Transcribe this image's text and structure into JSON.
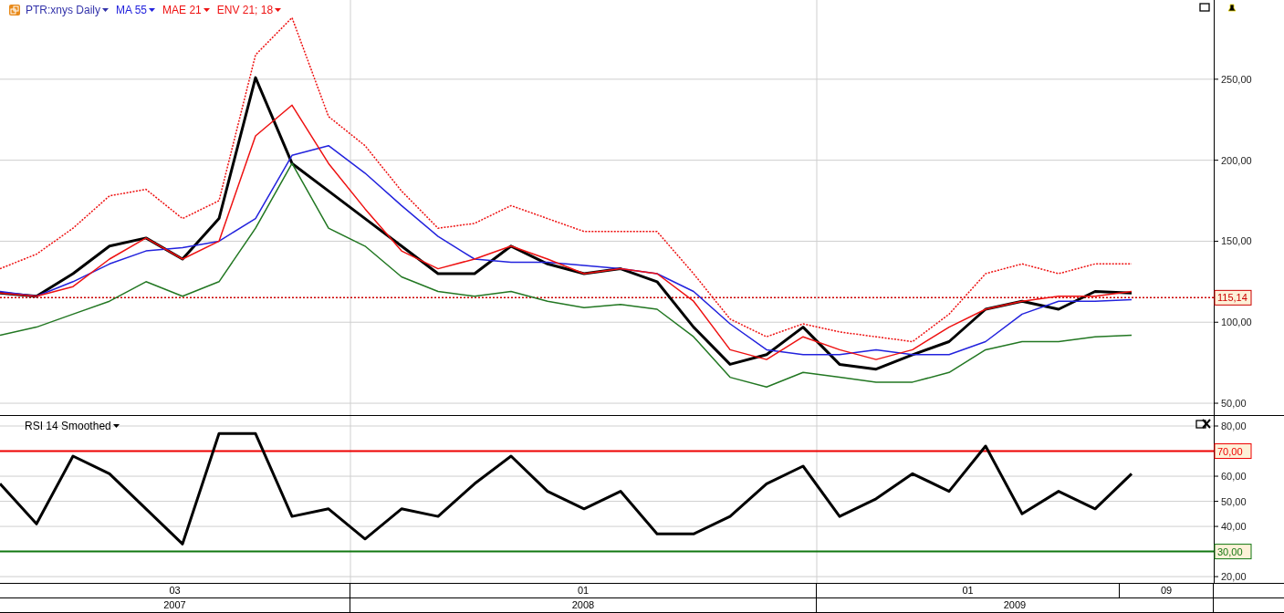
{
  "price_panel": {
    "legend": [
      {
        "label": "PTR:xnys Daily",
        "color": "#3333aa"
      },
      {
        "label": "MA 55",
        "color": "#2222dd"
      },
      {
        "label": "MAE 21",
        "color": "#ee1111"
      },
      {
        "label": "ENV 21; 18",
        "color": "#ee1111"
      }
    ],
    "chart_data": {
      "type": "line",
      "categories": [
        null,
        null,
        null,
        null,
        null,
        null,
        null,
        null,
        null,
        null,
        null,
        null,
        null,
        null,
        null,
        null,
        null,
        null,
        null,
        null,
        null,
        null,
        null,
        null,
        null,
        null,
        null,
        null,
        null,
        null,
        null,
        null
      ],
      "ylim": [
        42.7,
        298.9
      ],
      "grid": true,
      "yticks": [
        {
          "value": 250,
          "label": "250,00"
        },
        {
          "value": 200,
          "label": "200,00"
        },
        {
          "value": 150,
          "label": "150,00"
        },
        {
          "value": 100,
          "label": "100,00"
        },
        {
          "value": 50,
          "label": "50,00"
        }
      ],
      "series": [
        {
          "color": "#000000",
          "line_style": "solid",
          "values": [
            118,
            116,
            130,
            147,
            152,
            139,
            164,
            251,
            198,
            181,
            164,
            147,
            130,
            130,
            147,
            136,
            130,
            133,
            125,
            97,
            74,
            80,
            97,
            74,
            71,
            80,
            88,
            108,
            113,
            108,
            119,
            118
          ]
        },
        {
          "color": "#2222dd",
          "line_style": "solid",
          "values": [
            119,
            116,
            125,
            136,
            144,
            146,
            150,
            164,
            203,
            209,
            192,
            172,
            153,
            139,
            137,
            137,
            135,
            133,
            130,
            119,
            99,
            83,
            80,
            80,
            83,
            80,
            80,
            88,
            105,
            113,
            113,
            114
          ]
        },
        {
          "color": "#ee1111",
          "line_style": "solid",
          "values": [
            118,
            116,
            122,
            139,
            152,
            139,
            150,
            215,
            234,
            198,
            170,
            144,
            133,
            139,
            147,
            139,
            130,
            133,
            130,
            113,
            83,
            77,
            91,
            83,
            77,
            83,
            97,
            108,
            113,
            116,
            116,
            119
          ]
        },
        {
          "color": "#ee1111",
          "line_style": "dotted",
          "values": [
            133,
            142,
            158,
            178,
            182,
            164,
            175,
            265,
            288,
            227,
            209,
            181,
            158,
            161,
            172,
            164,
            156,
            156,
            156,
            130,
            102,
            91,
            99,
            94,
            91,
            88,
            105,
            130,
            136,
            130,
            136,
            136
          ]
        },
        {
          "color": "#227722",
          "line_style": "solid",
          "values": [
            92,
            97,
            105,
            113,
            125,
            116,
            125,
            158,
            198,
            158,
            147,
            128,
            119,
            116,
            119,
            113,
            109,
            111,
            108,
            91,
            66,
            60,
            69,
            66,
            63,
            63,
            69,
            83,
            88,
            88,
            91,
            92
          ]
        }
      ],
      "ref_lines": [
        {
          "axis": "y",
          "value": 115.14,
          "label": "115,14",
          "color": "#cc0000"
        }
      ]
    }
  },
  "rsi_panel": {
    "legend": [
      {
        "label": "RSI 14 Smoothed",
        "color": "#000000"
      }
    ],
    "chart_data": {
      "type": "line",
      "categories": [
        null,
        null,
        null,
        null,
        null,
        null,
        null,
        null,
        null,
        null,
        null,
        null,
        null,
        null,
        null,
        null,
        null,
        null,
        null,
        null,
        null,
        null,
        null,
        null,
        null,
        null,
        null,
        null,
        null,
        null,
        null,
        null
      ],
      "ylim": [
        17.5,
        84
      ],
      "grid": true,
      "yticks": [
        {
          "value": 80,
          "label": "80,00"
        },
        {
          "value": 60,
          "label": "60,00"
        },
        {
          "value": 50,
          "label": "50,00"
        },
        {
          "value": 40,
          "label": "40,00"
        },
        {
          "value": 20,
          "label": "20,00"
        }
      ],
      "series": [
        {
          "color": "#000000",
          "line_style": "solid",
          "values": [
            57,
            41,
            68,
            61,
            47,
            33,
            77,
            77,
            44,
            47,
            35,
            47,
            44,
            57,
            68,
            54,
            47,
            54,
            37,
            37,
            44,
            57,
            64,
            44,
            51,
            61,
            54,
            72,
            45,
            54,
            47,
            61
          ]
        }
      ],
      "ref_lines": [
        {
          "axis": "y",
          "value": 70,
          "label": "70,00",
          "color": "#ee0000"
        },
        {
          "axis": "y",
          "value": 30,
          "label": "30,00",
          "color": "#117711"
        }
      ]
    }
  },
  "x_axis": {
    "months": [
      "03",
      "01",
      "01",
      "09"
    ],
    "years": [
      "2007",
      "2008",
      "2009"
    ]
  }
}
